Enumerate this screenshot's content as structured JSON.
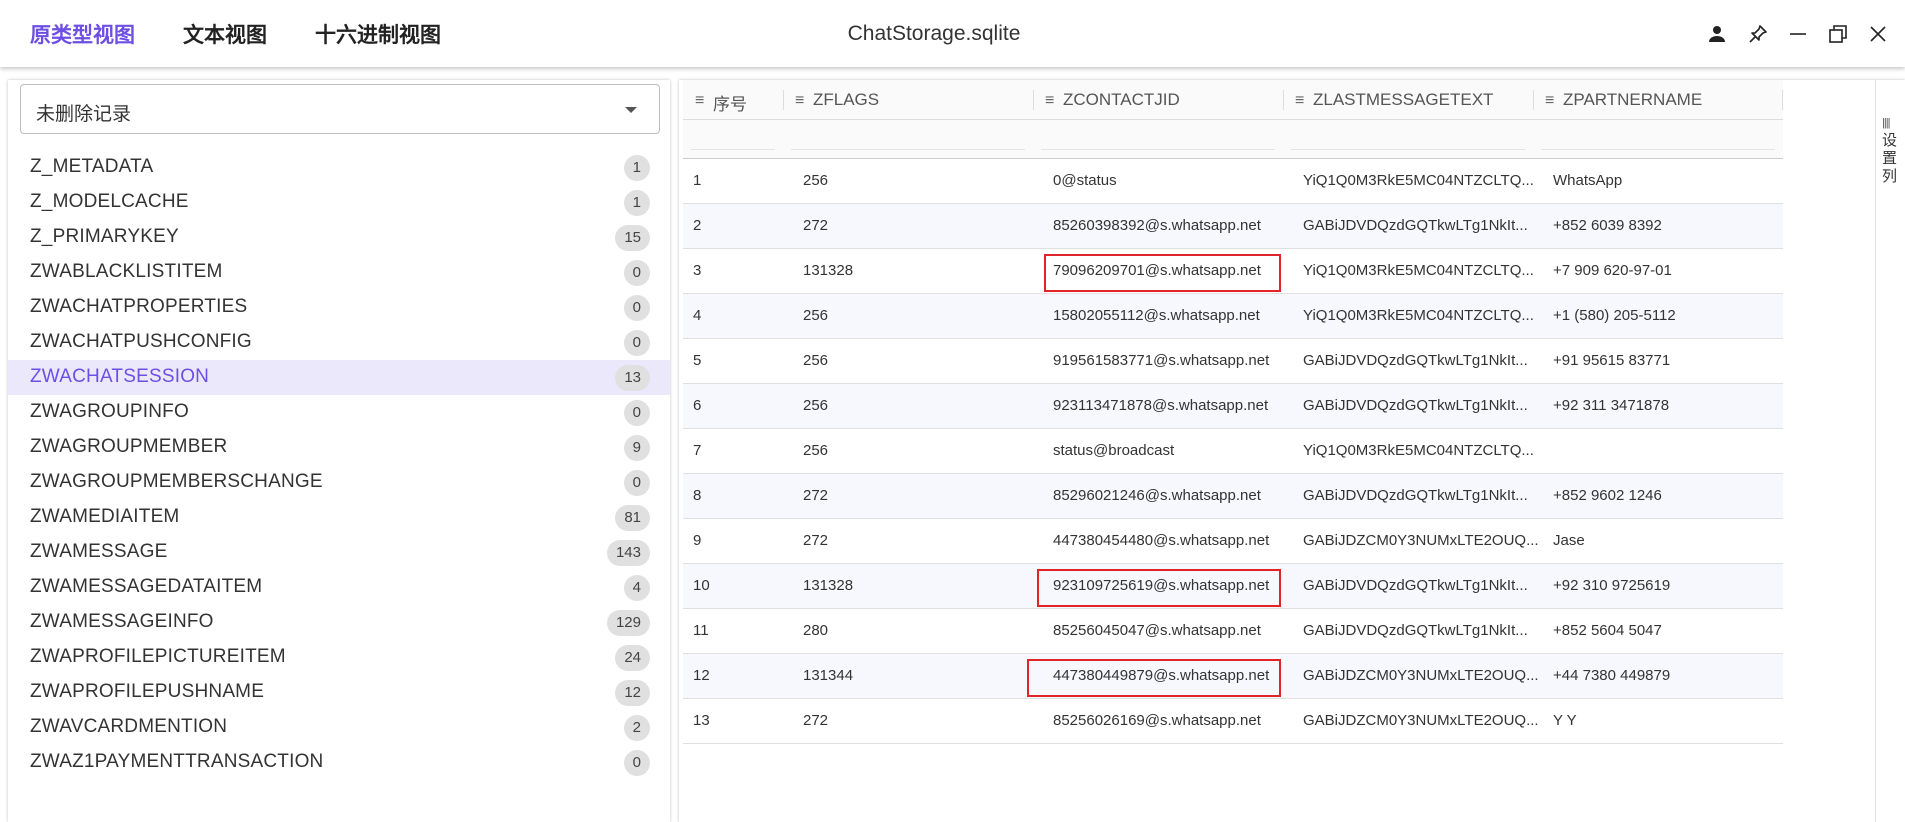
{
  "tabs": [
    {
      "label": "原类型视图",
      "active": true
    },
    {
      "label": "文本视图",
      "active": false
    },
    {
      "label": "十六进制视图",
      "active": false
    }
  ],
  "window_title": "ChatStorage.sqlite",
  "window_controls": [
    "person-icon",
    "pin-icon",
    "minimize-icon",
    "restore-icon",
    "close-icon"
  ],
  "accent_color": "#6d4fe4",
  "highlight_color": "#e0242a",
  "filter": {
    "selected": "未删除记录"
  },
  "tables": [
    {
      "name": "Z_METADATA",
      "count": "1"
    },
    {
      "name": "Z_MODELCACHE",
      "count": "1"
    },
    {
      "name": "Z_PRIMARYKEY",
      "count": "15"
    },
    {
      "name": "ZWABLACKLISTITEM",
      "count": "0"
    },
    {
      "name": "ZWACHATPROPERTIES",
      "count": "0"
    },
    {
      "name": "ZWACHATPUSHCONFIG",
      "count": "0"
    },
    {
      "name": "ZWACHATSESSION",
      "count": "13",
      "selected": true
    },
    {
      "name": "ZWAGROUPINFO",
      "count": "0"
    },
    {
      "name": "ZWAGROUPMEMBER",
      "count": "9"
    },
    {
      "name": "ZWAGROUPMEMBERSCHANGE",
      "count": "0"
    },
    {
      "name": "ZWAMEDIAITEM",
      "count": "81"
    },
    {
      "name": "ZWAMESSAGE",
      "count": "143"
    },
    {
      "name": "ZWAMESSAGEDATAITEM",
      "count": "4"
    },
    {
      "name": "ZWAMESSAGEINFO",
      "count": "129"
    },
    {
      "name": "ZWAPROFILEPICTUREITEM",
      "count": "24"
    },
    {
      "name": "ZWAPROFILEPUSHNAME",
      "count": "12"
    },
    {
      "name": "ZWAVCARDMENTION",
      "count": "2"
    },
    {
      "name": "ZWAZ1PAYMENTTRANSACTION",
      "count": "0"
    }
  ],
  "grid": {
    "columns": [
      "序号",
      "ZFLAGS",
      "ZCONTACTJID",
      "ZLASTMESSAGETEXT",
      "ZPARTNERNAME"
    ],
    "rows": [
      [
        "1",
        "256",
        "0@status",
        "YiQ1Q0M3RkE5MC04NTZCLTQ...",
        "WhatsApp"
      ],
      [
        "2",
        "272",
        "85260398392@s.whatsapp.net",
        "GABiJDVDQzdGQTkwLTg1NkIt...",
        "+852 6039 8392"
      ],
      [
        "3",
        "131328",
        "79096209701@s.whatsapp.net",
        "YiQ1Q0M3RkE5MC04NTZCLTQ...",
        "+7 909 620-97-01"
      ],
      [
        "4",
        "256",
        "15802055112@s.whatsapp.net",
        "YiQ1Q0M3RkE5MC04NTZCLTQ...",
        "+1 (580) 205-5112"
      ],
      [
        "5",
        "256",
        "919561583771@s.whatsapp.net",
        "GABiJDVDQzdGQTkwLTg1NkIt...",
        "+91 95615 83771"
      ],
      [
        "6",
        "256",
        "923113471878@s.whatsapp.net",
        "GABiJDVDQzdGQTkwLTg1NkIt...",
        "+92 311 3471878"
      ],
      [
        "7",
        "256",
        "status@broadcast",
        "YiQ1Q0M3RkE5MC04NTZCLTQ...",
        ""
      ],
      [
        "8",
        "272",
        "85296021246@s.whatsapp.net",
        "GABiJDVDQzdGQTkwLTg1NkIt...",
        "+852 9602 1246"
      ],
      [
        "9",
        "272",
        "447380454480@s.whatsapp.net",
        "GABiJDZCM0Y3NUMxLTE2OUQ...",
        "Jase"
      ],
      [
        "10",
        "131328",
        "923109725619@s.whatsapp.net",
        "GABiJDVDQzdGQTkwLTg1NkIt...",
        "+92 310 9725619"
      ],
      [
        "11",
        "280",
        "85256045047@s.whatsapp.net",
        "GABiJDVDQzdGQTkwLTg1NkIt...",
        "+852 5604 5047"
      ],
      [
        "12",
        "131344",
        "447380449879@s.whatsapp.net",
        "GABiJDZCM0Y3NUMxLTE2OUQ...",
        "+44 7380 449879"
      ],
      [
        "13",
        "272",
        "85256026169@s.whatsapp.net",
        "GABiJDZCM0Y3NUMxLTE2OUQ...",
        "Y Y"
      ]
    ],
    "highlighted_rows": [
      3,
      10,
      12
    ]
  },
  "settings_panel": {
    "icon": "columns-icon",
    "label": "设置列"
  }
}
